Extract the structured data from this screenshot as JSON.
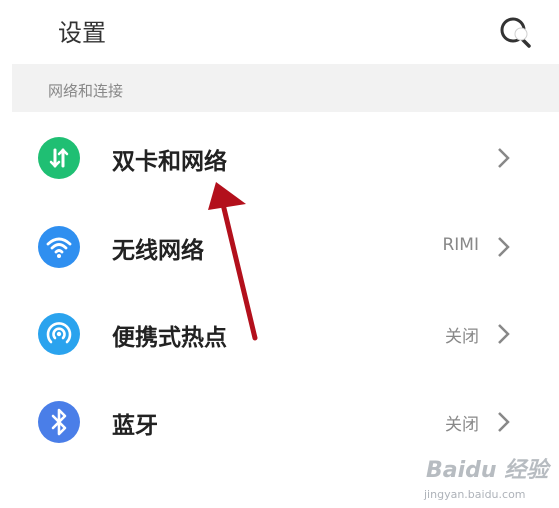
{
  "header": {
    "title": "设置",
    "search_icon": "search-icon"
  },
  "section": {
    "label": "网络和连接"
  },
  "items": [
    {
      "label": "双卡和网络",
      "value": "",
      "icon": "dual-sim-icon",
      "color": "#1fbf73"
    },
    {
      "label": "无线网络",
      "value": "RIMI",
      "icon": "wifi-icon",
      "color": "#2f8ff0"
    },
    {
      "label": "便携式热点",
      "value": "关闭",
      "icon": "hotspot-icon",
      "color": "#2aa3ee"
    },
    {
      "label": "蓝牙",
      "value": "关闭",
      "icon": "bluetooth-icon",
      "color": "#4a7ee8"
    }
  ],
  "annotation": {
    "color": "#b3101c"
  },
  "watermark": {
    "brand": "Baidu 经验",
    "url": "jingyan.baidu.com"
  }
}
